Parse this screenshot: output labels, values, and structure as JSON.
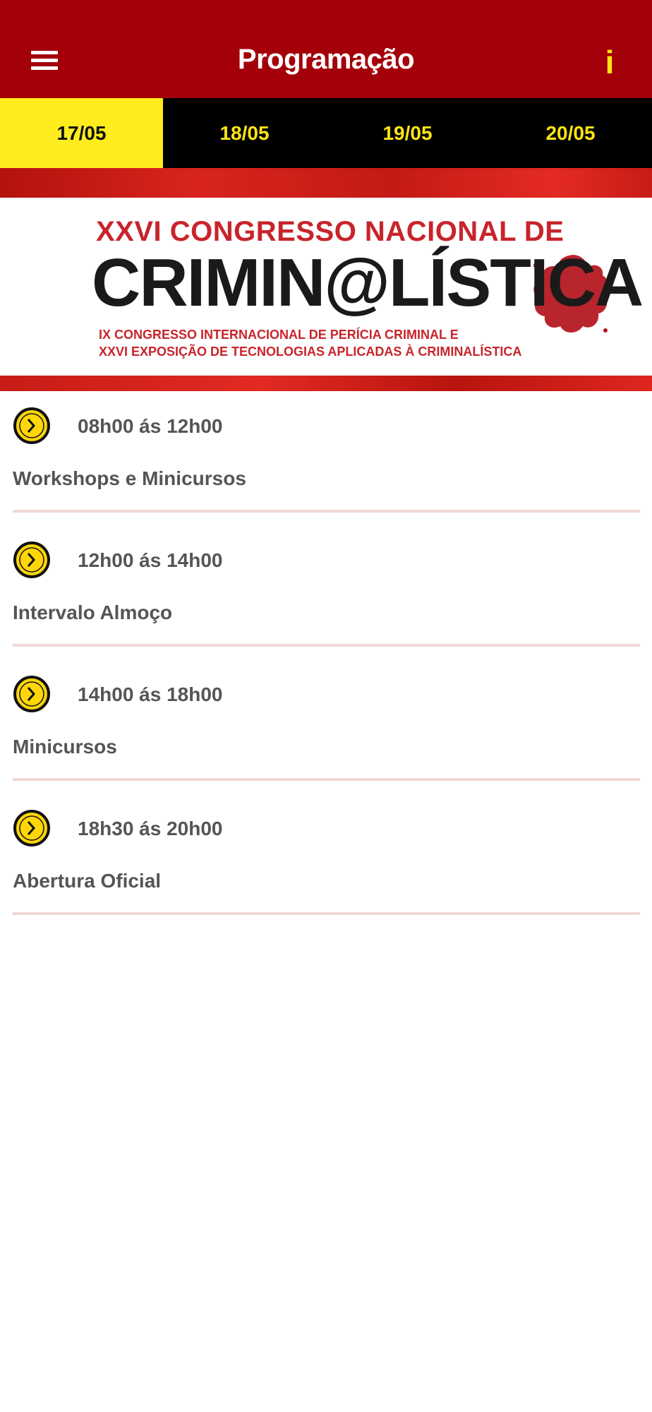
{
  "header": {
    "title": "Programação",
    "info_label": "i",
    "menu_icon": "hamburger-menu-icon",
    "bg_color": "#a30009",
    "accent_color": "#ffe415"
  },
  "tabs": [
    {
      "label": "17/05",
      "active": true
    },
    {
      "label": "18/05",
      "active": false
    },
    {
      "label": "19/05",
      "active": false
    },
    {
      "label": "20/05",
      "active": false
    }
  ],
  "banner": {
    "line1": "XXVI CONGRESSO NACIONAL DE",
    "line2": "CRIMIN@LÍSTICA",
    "line3": "IX CONGRESSO INTERNACIONAL DE PERÍCIA CRIMINAL E",
    "line4": "XXVI EXPOSIÇÃO DE TECNOLOGIAS APLICADAS À CRIMINALÍSTICA"
  },
  "schedule": [
    {
      "time": "08h00 ás 12h00",
      "title": "Workshops e Minicursos",
      "icon": "clock-icon"
    },
    {
      "time": "12h00 ás 14h00",
      "title": "Intervalo Almoço",
      "icon": "clock-icon"
    },
    {
      "time": "14h00 ás 18h00",
      "title": "Minicursos",
      "icon": "clock-icon"
    },
    {
      "time": "18h30 ás 20h00",
      "title": "Abertura Oficial",
      "icon": "clock-icon"
    }
  ]
}
